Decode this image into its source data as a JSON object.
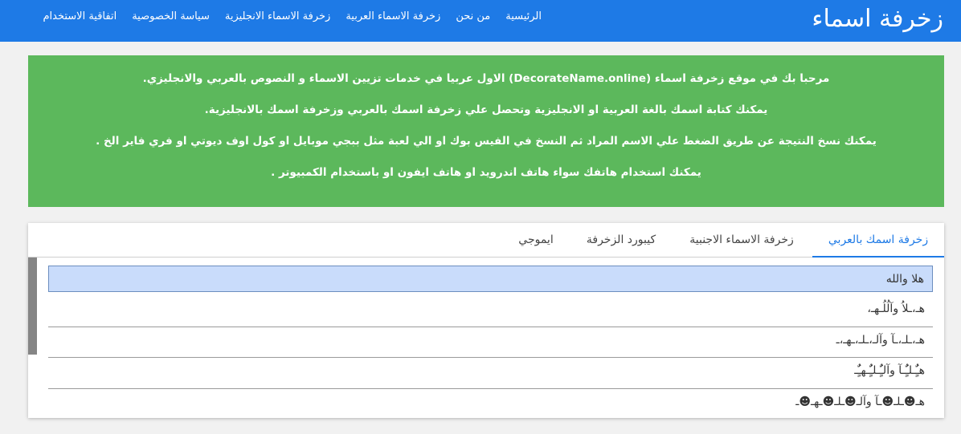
{
  "navbar": {
    "brand": "زخرفة اسماء",
    "links": [
      {
        "label": "الرئيسية"
      },
      {
        "label": "من نحن"
      },
      {
        "label": "زخرفة الاسماء العربية"
      },
      {
        "label": "زخرفة الاسماء الانجليزية"
      },
      {
        "label": "سياسة الخصوصية"
      },
      {
        "label": "اتفاقية الاستخدام"
      }
    ],
    "color": "#1e7ae6"
  },
  "intro": {
    "color": "#5cb85c",
    "lines": [
      "مرحبا بك في موقع زخرفة اسماء (DecorateName.online) الاول عربيا في خدمات تزيين الاسماء و النصوص بالعربي والانجليزي.",
      "يمكنك كتابة اسمك بالغة العربية او الانجليزية وتحصل علي زخرفة اسمك بالعربي وزخرفة اسمك بالانجليزية.",
      "يمكنك نسخ النتيجة عن طريق الضغط علي الاسم المراد ثم النسخ في الفيس بوك او الي لعبة مثل ببجي موبايل او كول اوف ديوتي او فري فاير الخ .",
      "يمكنك استخدام هاتفك سواء هاتف اندرويد او هاتف ايفون او باستخدام الكمبيوتر ."
    ]
  },
  "tabs": [
    {
      "label": "زخرفة اسمك بالعربي",
      "active": true
    },
    {
      "label": "زخرفة الاسماء الاجنبية",
      "active": false
    },
    {
      "label": "كيبورد الزخرفة",
      "active": false
    },
    {
      "label": "ايموجي",
      "active": false
    }
  ],
  "results": [
    "هلا والله",
    "هـ،ـلاُ وآلُلُـهـ،",
    "هـ،ـلـ،ـآ وآلـ،ـلـ،ـهـ،ـ",
    "هـٌٍُـلـٌٍُـآ وآلـٌٍُـلـٌٍُـهـٌٍُـ",
    "هـ☻ـلـ☻ـآ وآلـ☻ـلـ☻ـهـ☻ـ"
  ],
  "selected_color": "#c9dcfb"
}
